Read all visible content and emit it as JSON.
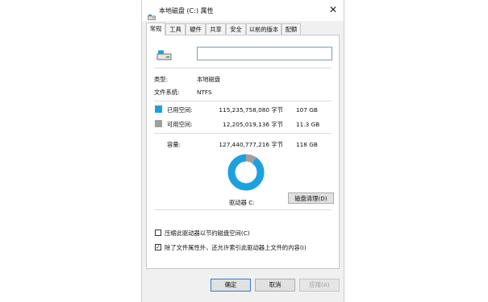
{
  "window": {
    "title": "本地磁盘 (C:) 属性",
    "close_glyph": "✕"
  },
  "tabs": [
    {
      "label": "常规"
    },
    {
      "label": "工具"
    },
    {
      "label": "硬件"
    },
    {
      "label": "共享"
    },
    {
      "label": "安全"
    },
    {
      "label": "以前的版本"
    },
    {
      "label": "配额"
    }
  ],
  "general": {
    "name_value": "",
    "type_label": "类型:",
    "type_value": "本地磁盘",
    "fs_label": "文件系统:",
    "fs_value": "NTFS",
    "used": {
      "label": "已用空间:",
      "bytes": "115,235,758,080 字节",
      "size": "107 GB",
      "color": "#1ba1e2"
    },
    "free": {
      "label": "可用空间:",
      "bytes": "12,205,019,136 字节",
      "size": "11.3 GB",
      "color": "#a0a0a0"
    },
    "capacity": {
      "label": "容量:",
      "bytes": "127,440,777,216 字节",
      "size": "118 GB"
    },
    "used_fraction": 0.904,
    "drive_label": "驱动器 C:",
    "cleanup_button": "磁盘清理(D)",
    "compress_label": "压缩此驱动器以节约磁盘空间(C)",
    "compress_checked": false,
    "index_label": "除了文件属性外，还允许索引此驱动器上文件的内容(I)",
    "index_checked": true
  },
  "buttons": {
    "ok": "确定",
    "cancel": "取消",
    "apply": "应用(A)"
  }
}
